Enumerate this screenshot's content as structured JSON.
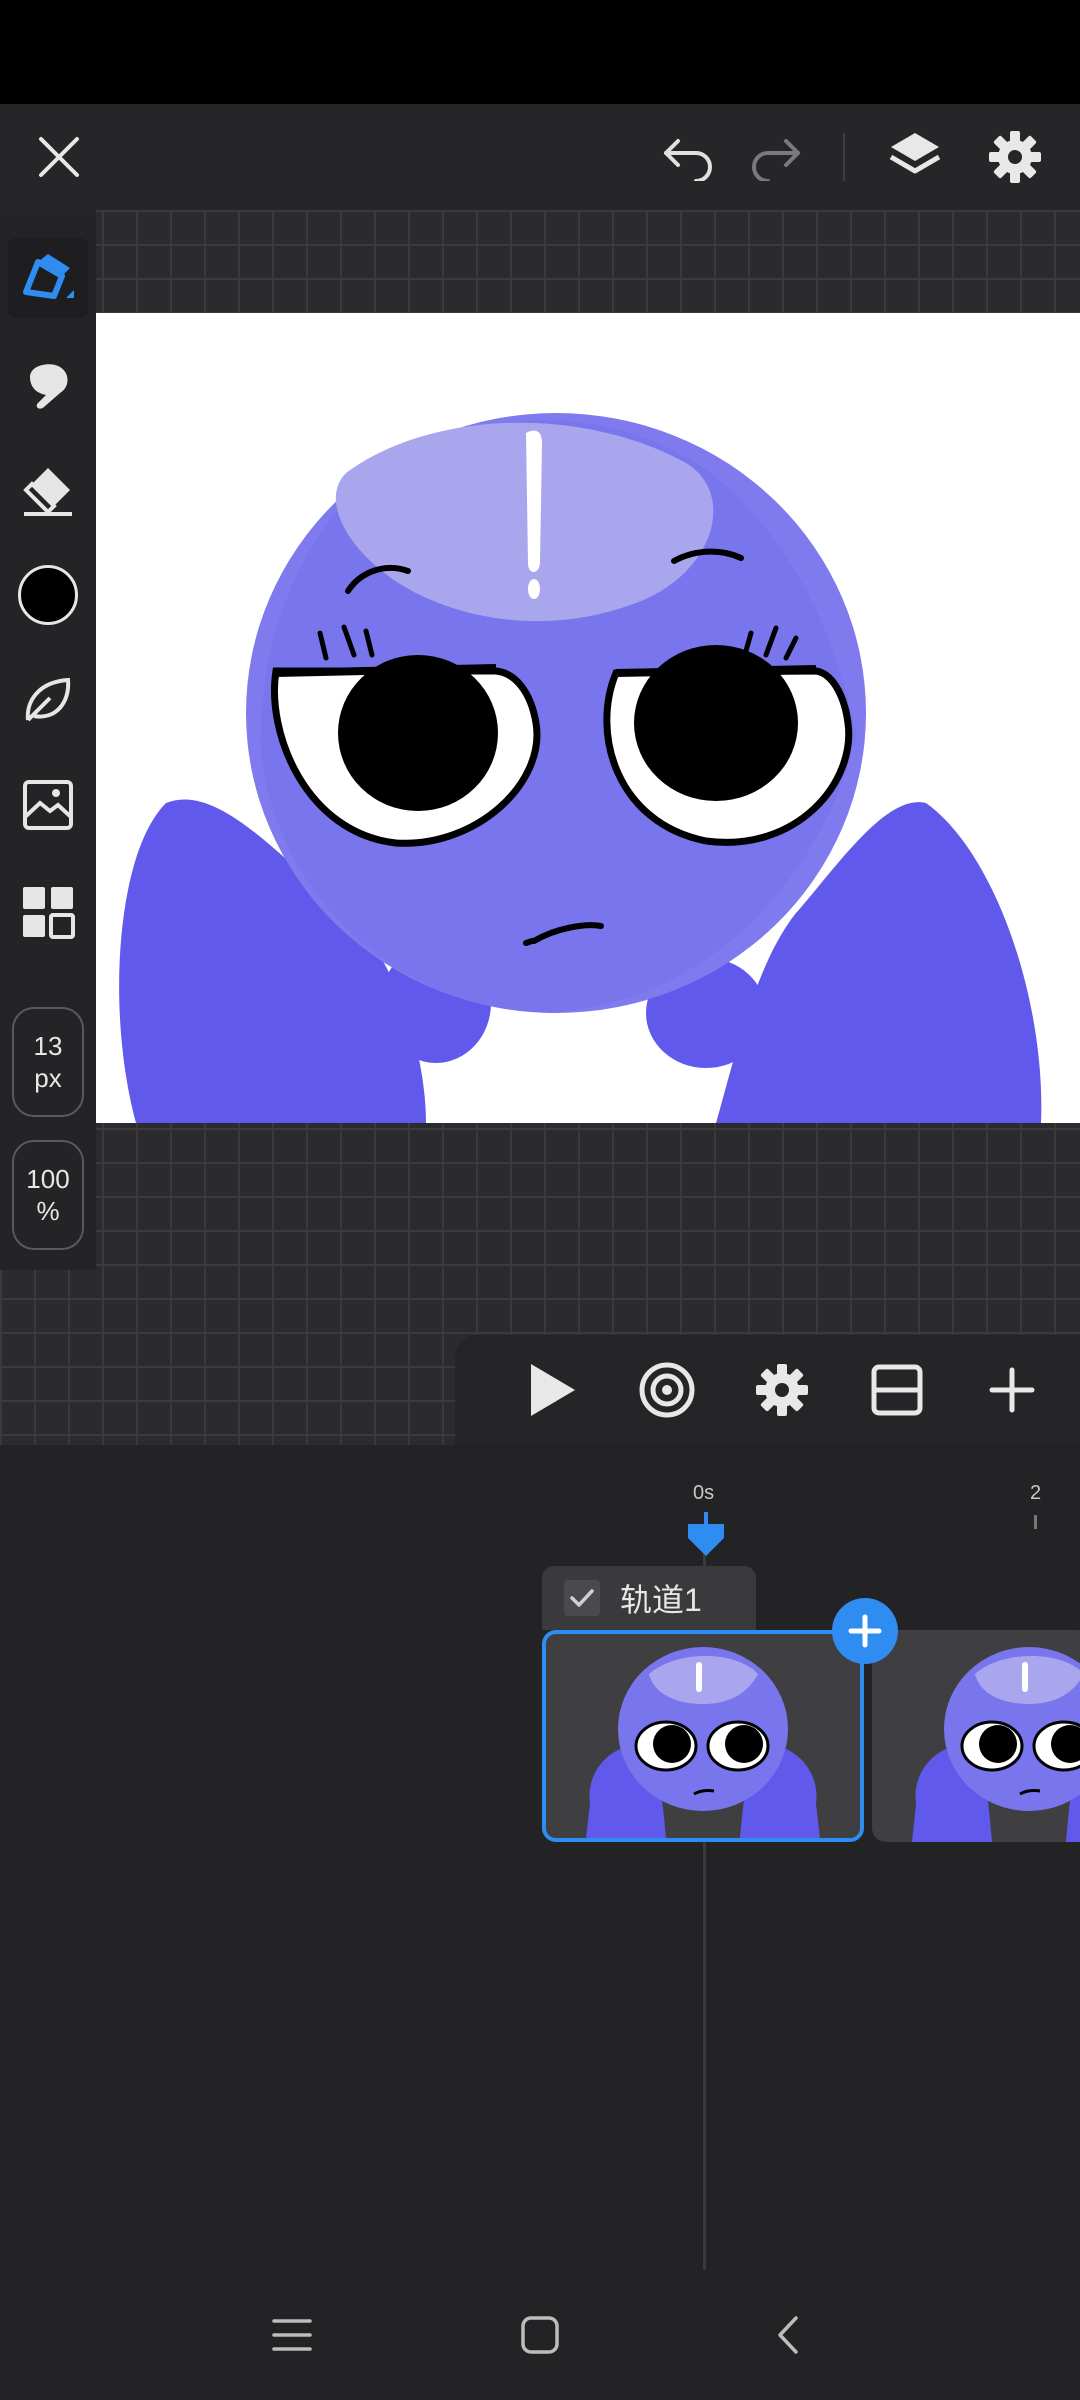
{
  "topbar": {
    "icons": [
      "close-icon",
      "undo-icon",
      "redo-icon",
      "layers-icon",
      "settings-icon"
    ]
  },
  "sidebar": {
    "tools": [
      "pen-icon",
      "smudge-icon",
      "eraser-icon",
      "color-swatch",
      "lasso-icon",
      "image-import-icon",
      "grid-layout-icon"
    ],
    "current_color": "#000000",
    "brush_size": {
      "value": "13",
      "unit": "px"
    },
    "zoom": {
      "value": "100",
      "unit": "%"
    }
  },
  "canvas": {
    "background": "#ffffff",
    "character_color": "#6a62e8",
    "highlight_color": "#aaa6ee"
  },
  "playbar": {
    "icons": [
      "play-icon",
      "onion-skin-icon",
      "settings-icon",
      "split-view-icon",
      "add-icon"
    ]
  },
  "timeline": {
    "ruler": {
      "start_label": "0s",
      "end_label": "2"
    },
    "track": {
      "name": "轨道1",
      "checked": true
    },
    "frames": [
      {
        "selected": true
      },
      {
        "selected": false
      }
    ],
    "accent": "#2f8cf0"
  },
  "navbar": {
    "icons": [
      "menu-icon",
      "home-icon",
      "back-icon"
    ]
  }
}
